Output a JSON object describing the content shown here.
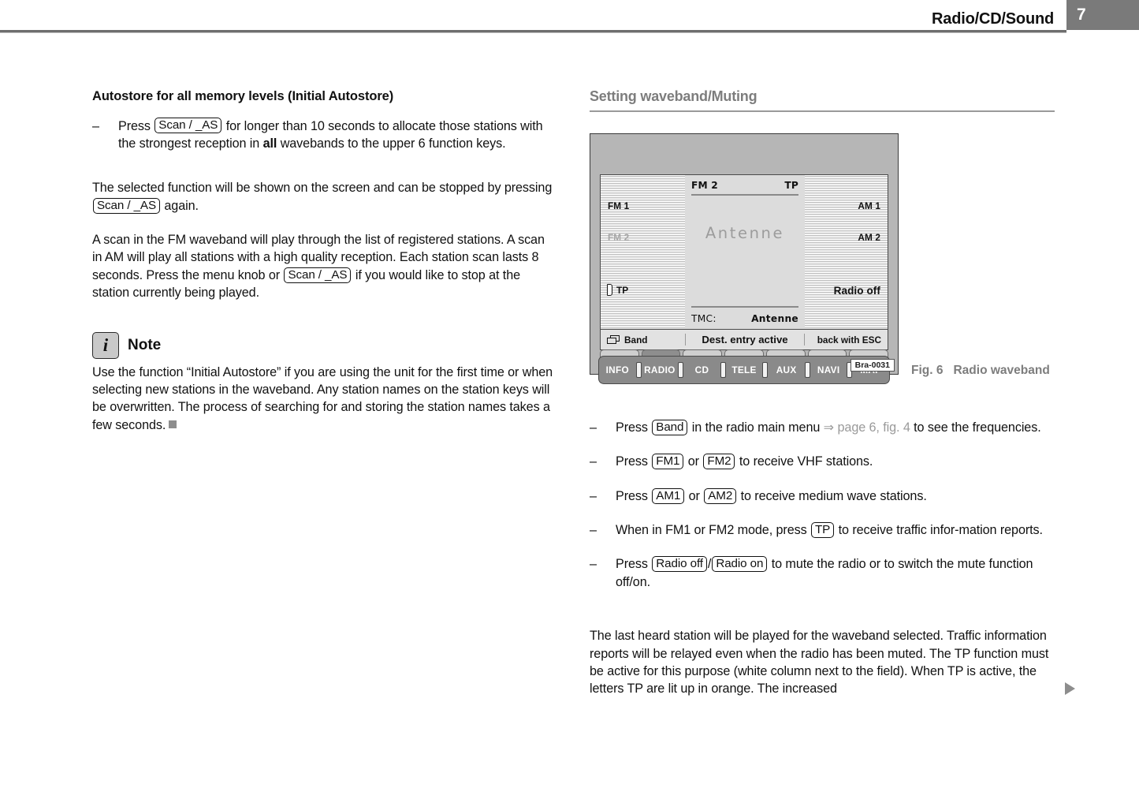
{
  "header": {
    "title": "Radio/CD/Sound",
    "page_number": "7"
  },
  "left_column": {
    "heading": "Autostore for all memory levels (Initial Autostore)",
    "bullet1": {
      "dash": "–",
      "part1": "Press",
      "key": "Scan / _AS",
      "part2": "for longer than 10 seconds to allocate those stations with the strongest reception in",
      "bold_word": "all",
      "part3": "wavebands to the upper 6 function keys."
    },
    "para1": {
      "part1": "The selected function will be shown on the screen and can be stopped by pressing",
      "key": "Scan / _AS",
      "part2": "again."
    },
    "para2": {
      "part1": "A scan in the FM waveband will play through the list of registered stations. A scan in AM will play all stations with a high quality reception. Each station scan lasts 8 seconds. Press the menu knob or",
      "key": "Scan / _AS",
      "part2": "if you would like to stop at the station currently being played."
    },
    "note": {
      "icon": "info-icon",
      "icon_glyph": "i",
      "title": "Note",
      "text": "Use the function “Initial Autostore” if you are using the unit for the first time or when selecting new stations in the waveband. Any station names on the station keys will be overwritten. The process of searching for and storing the station names takes a few seconds."
    }
  },
  "right_column": {
    "section_heading": "Setting waveband/Muting",
    "figure": {
      "caption_label": "Fig. 6",
      "caption_text": "Radio waveband",
      "code": "Bra-0031",
      "screen": {
        "left_panel": {
          "fm1": "FM 1",
          "fm2": "FM 2",
          "tp": "TP"
        },
        "center_panel": {
          "band": "FM 2",
          "tp": "TP",
          "station": "Antenne",
          "tmc_label": "TMC:",
          "tmc_value": "Antenne"
        },
        "right_panel": {
          "am1": "AM 1",
          "am2": "AM 2",
          "radio_off": "Radio off"
        },
        "soft_keys": {
          "band": "Band",
          "band_icon": "band-swap-icon",
          "center": "Dest. entry active",
          "right": "back with ESC"
        }
      },
      "buttons": [
        "INFO",
        "RADIO",
        "CD",
        "TELE",
        "AUX",
        "NAVI",
        "MAP"
      ]
    },
    "bullets": [
      {
        "dash": "–",
        "part1": "Press",
        "key": "Band",
        "part2": "in the radio main menu",
        "xref": "⇒ page 6, fig. 4",
        "part3": "to see the frequencies."
      },
      {
        "dash": "–",
        "part1": "Press",
        "key": "FM1",
        "mid": "or",
        "key2": "FM2",
        "part2": "to receive VHF stations."
      },
      {
        "dash": "–",
        "part1": "Press",
        "key": "AM1",
        "mid": "or",
        "key2": "AM2",
        "part2": "to receive medium wave stations."
      },
      {
        "dash": "–",
        "part1": "When in FM1 or FM2 mode, press",
        "key": "TP",
        "part2": "to receive traffic infor-mation reports."
      },
      {
        "dash": "–",
        "part1": "Press",
        "key": "Radio off",
        "slash": "/",
        "key2": "Radio on",
        "part2": "to mute the radio or to switch the mute function off/on."
      }
    ],
    "closing_paragraph": "The last heard station will be played for the waveband selected. Traffic information reports will be relayed even when the radio has been muted. The TP function must be active for this purpose (white column next to the field). When TP is active, the letters TP are lit up in orange. The increased"
  },
  "colors": {
    "header_gray": "#7a7a7a",
    "section_head_gray": "#7d7d7d",
    "xref_gray": "#9a9a9a",
    "unit_body": "#b6b6b6",
    "screen_bg": "#d8d8d8"
  }
}
